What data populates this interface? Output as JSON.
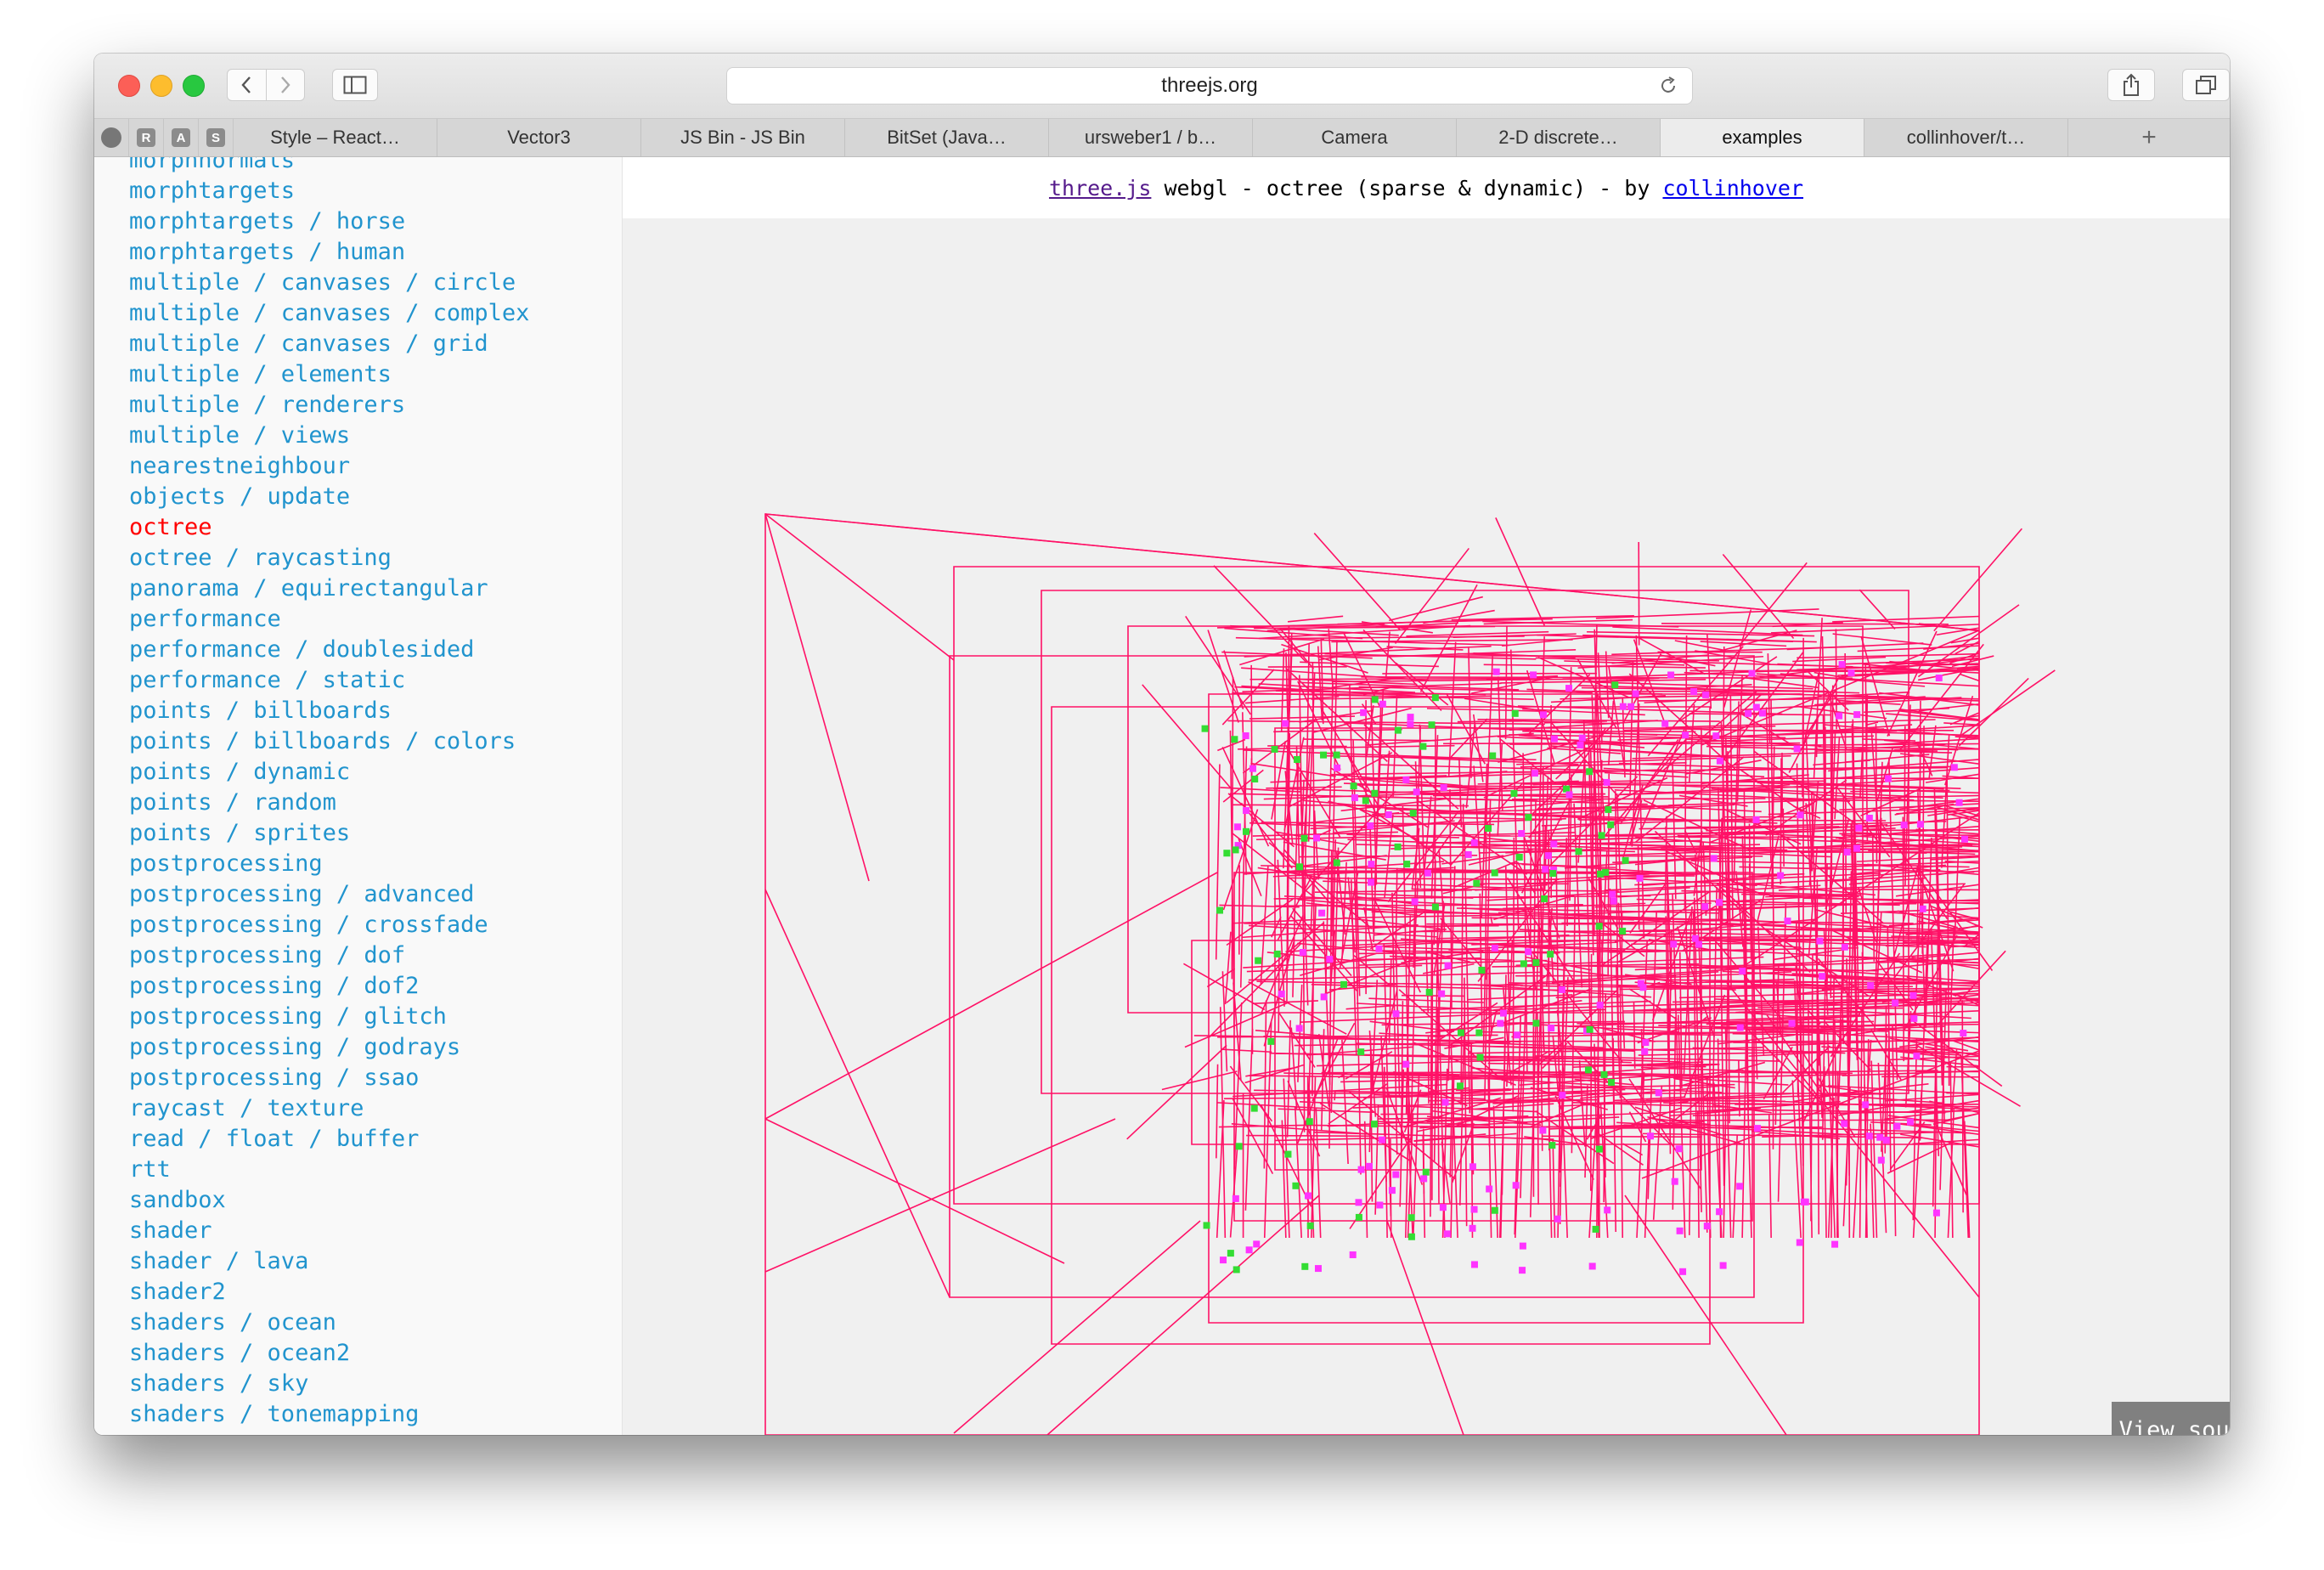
{
  "browser": {
    "url": "threejs.org",
    "pinned_tabs": [
      {
        "icon": "github-icon",
        "letter": ""
      },
      {
        "icon": "r-icon",
        "letter": "R"
      },
      {
        "icon": "a-icon",
        "letter": "A"
      },
      {
        "icon": "s-icon",
        "letter": "S"
      }
    ],
    "tabs": [
      {
        "label": "Style – React…"
      },
      {
        "label": "Vector3"
      },
      {
        "label": "JS Bin - JS Bin"
      },
      {
        "label": "BitSet (Java…"
      },
      {
        "label": "ursweber1 / b…"
      },
      {
        "label": "Camera"
      },
      {
        "label": "2-D discrete…"
      },
      {
        "label": "examples"
      },
      {
        "label": "collinhover/t…"
      }
    ],
    "active_tab": "examples",
    "new_tab_label": "+"
  },
  "sidebar": {
    "selected": "octree",
    "items": [
      "morphnormals",
      "morphtargets",
      "morphtargets / horse",
      "morphtargets / human",
      "multiple / canvases / circle",
      "multiple / canvases / complex",
      "multiple / canvases / grid",
      "multiple / elements",
      "multiple / renderers",
      "multiple / views",
      "nearestneighbour",
      "objects / update",
      "octree",
      "octree / raycasting",
      "panorama / equirectangular",
      "performance",
      "performance / doublesided",
      "performance / static",
      "points / billboards",
      "points / billboards / colors",
      "points / dynamic",
      "points / random",
      "points / sprites",
      "postprocessing",
      "postprocessing / advanced",
      "postprocessing / crossfade",
      "postprocessing / dof",
      "postprocessing / dof2",
      "postprocessing / glitch",
      "postprocessing / godrays",
      "postprocessing / ssao",
      "raycast / texture",
      "read / float / buffer",
      "rtt",
      "sandbox",
      "shader",
      "shader / lava",
      "shader2",
      "shaders / ocean",
      "shaders / ocean2",
      "shaders / sky",
      "shaders / tonemapping"
    ]
  },
  "example": {
    "link_threejs": "three.js",
    "text_middle": " webgl - octree (sparse & dynamic) - by ",
    "link_author": "collinhover",
    "view_source": "View source"
  },
  "colors": {
    "octree_lines": "#ff1166",
    "points_magenta": "#ff33ff",
    "points_green": "#33dd33",
    "link": "#2194ce",
    "selected": "#ff0000"
  }
}
